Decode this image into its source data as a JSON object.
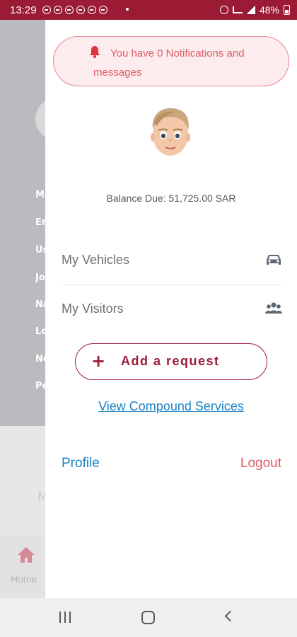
{
  "status_bar": {
    "time": "13:29",
    "battery": "48%"
  },
  "background_app": {
    "nav_items": [
      "M",
      "En",
      "Us",
      "Jo",
      "Na",
      "Lo",
      "No",
      "Pe"
    ],
    "mid_letter": "M",
    "home_label": "Home"
  },
  "drawer": {
    "notification_text_line1": "You have 0 Notifications and",
    "notification_text_line2": "messages",
    "balance": "Balance Due: 51,725.00 SAR",
    "menu": [
      {
        "label": "My Vehicles",
        "icon": "car-icon"
      },
      {
        "label": "My Visitors",
        "icon": "users-icon"
      }
    ],
    "add_request": {
      "plus": "+",
      "label": "Add a request"
    },
    "services_link": "View Compound Services",
    "profile_link": "Profile",
    "logout_link": "Logout"
  },
  "colors": {
    "brand": "#9b1b35",
    "notification": "#e05b66",
    "link": "#1a83c6"
  }
}
